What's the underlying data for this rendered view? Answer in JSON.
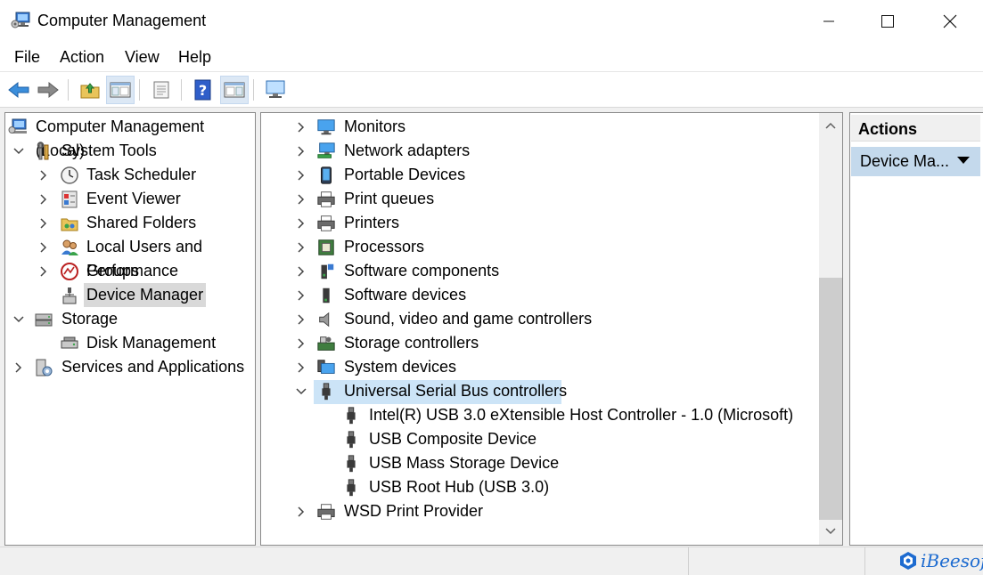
{
  "window": {
    "title": "Computer Management",
    "icon": "computer-management-icon"
  },
  "menu": [
    "File",
    "Action",
    "View",
    "Help"
  ],
  "toolbar": {
    "icons": [
      "back-arrow-icon",
      "forward-arrow-icon",
      "up-folder-icon",
      "show-hide-tree-icon",
      "properties-icon",
      "help-icon",
      "show-hide-action-pane-icon",
      "monitor-icon"
    ]
  },
  "tree": [
    {
      "label": "Computer Management (Local)",
      "icon": "computer-management-icon",
      "expanded": true
    },
    {
      "label": "System Tools",
      "icon": "tools-icon",
      "expanded": true
    },
    {
      "label": "Task Scheduler",
      "icon": "clock-icon"
    },
    {
      "label": "Event Viewer",
      "icon": "event-viewer-icon"
    },
    {
      "label": "Shared Folders",
      "icon": "shared-folder-icon"
    },
    {
      "label": "Local Users and Groups",
      "icon": "users-icon"
    },
    {
      "label": "Performance",
      "icon": "performance-icon"
    },
    {
      "label": "Device Manager",
      "icon": "device-manager-icon",
      "selected": true
    },
    {
      "label": "Storage",
      "icon": "storage-icon",
      "expanded": true
    },
    {
      "label": "Disk Management",
      "icon": "disk-icon"
    },
    {
      "label": "Services and Applications",
      "icon": "services-icon"
    }
  ],
  "devices": [
    {
      "label": "Monitors",
      "icon": "monitor-icon"
    },
    {
      "label": "Network adapters",
      "icon": "network-icon"
    },
    {
      "label": "Portable Devices",
      "icon": "portable-device-icon"
    },
    {
      "label": "Print queues",
      "icon": "printer-icon"
    },
    {
      "label": "Printers",
      "icon": "printer-icon"
    },
    {
      "label": "Processors",
      "icon": "processor-icon"
    },
    {
      "label": "Software components",
      "icon": "software-component-icon"
    },
    {
      "label": "Software devices",
      "icon": "software-device-icon"
    },
    {
      "label": "Sound, video and game controllers",
      "icon": "speaker-icon"
    },
    {
      "label": "Storage controllers",
      "icon": "storage-controller-icon"
    },
    {
      "label": "System devices",
      "icon": "system-device-icon"
    },
    {
      "label": "Universal Serial Bus controllers",
      "icon": "usb-icon",
      "expanded": true,
      "selected": true
    },
    {
      "label": "Intel(R) USB 3.0 eXtensible Host Controller - 1.0 (Microsoft)",
      "icon": "usb-icon"
    },
    {
      "label": "USB Composite Device",
      "icon": "usb-icon"
    },
    {
      "label": "USB Mass Storage Device",
      "icon": "usb-icon"
    },
    {
      "label": "USB Root Hub (USB 3.0)",
      "icon": "usb-icon"
    },
    {
      "label": "WSD Print Provider",
      "icon": "printer-icon"
    }
  ],
  "actions": {
    "header": "Actions",
    "item": "Device Ma..."
  },
  "watermark": "iBeesoft"
}
